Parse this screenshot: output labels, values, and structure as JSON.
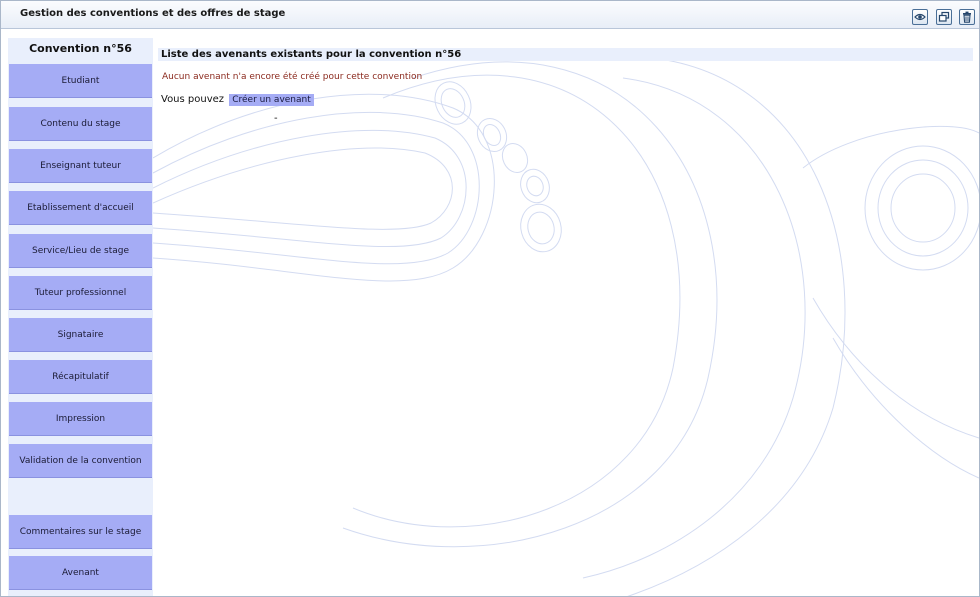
{
  "window": {
    "title": "Gestion des conventions et des offres de stage",
    "buttons": [
      "view-icon",
      "restore-icon",
      "trash-icon"
    ]
  },
  "sidebar": {
    "title": "Convention n°56",
    "items": [
      {
        "label": "Etudiant"
      },
      {
        "label": "Contenu du stage"
      },
      {
        "label": "Enseignant tuteur"
      },
      {
        "label": "Etablissement d'accueil"
      },
      {
        "label": "Service/Lieu de stage"
      },
      {
        "label": "Tuteur professionnel"
      },
      {
        "label": "Signataire"
      },
      {
        "label": "Récapitulatif"
      },
      {
        "label": "Impression"
      },
      {
        "label": "Validation de la convention"
      },
      {
        "label": "Commentaires sur le stage"
      },
      {
        "label": "Avenant"
      }
    ]
  },
  "main": {
    "header": "Liste des avenants existants pour la convention n°56",
    "notice": "Aucun avenant n'a encore été créé pour cette convention",
    "create_prefix": "Vous pouvez",
    "create_link": "Créer un avenant",
    "separator": "-"
  },
  "colors": {
    "menu_item": "#a5acf5",
    "sidebar_bg": "#e9effc",
    "notice_text": "#8b2a1e"
  }
}
